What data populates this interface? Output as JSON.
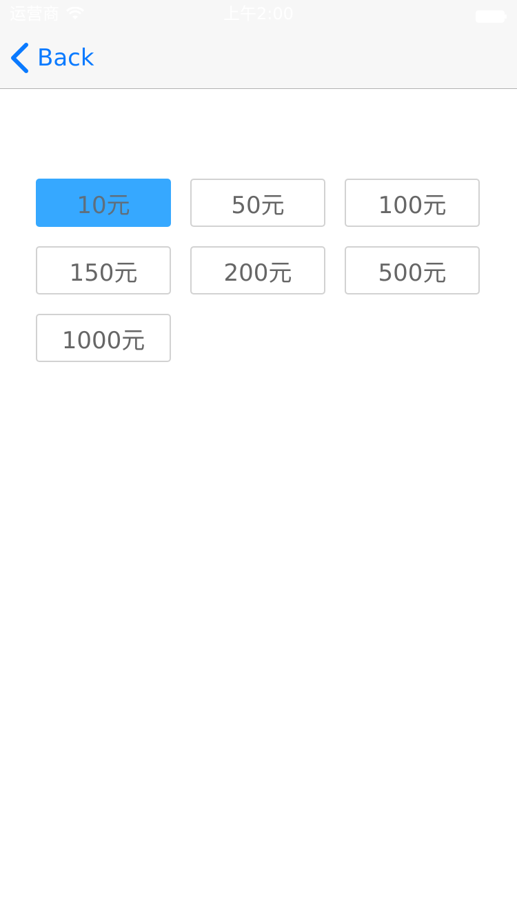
{
  "status_bar": {
    "carrier": "运营商",
    "time": "上午2:00",
    "wifi_icon": "wifi-icon",
    "battery_icon": "battery-icon"
  },
  "nav": {
    "back_label": "Back",
    "back_icon": "chevron-left-icon",
    "accent_color": "#0a7aff"
  },
  "amounts": {
    "selected_index": 0,
    "selected_color": "#36a8ff",
    "options": [
      {
        "label": "10元"
      },
      {
        "label": "50元"
      },
      {
        "label": "100元"
      },
      {
        "label": "150元"
      },
      {
        "label": "200元"
      },
      {
        "label": "500元"
      },
      {
        "label": "1000元"
      }
    ]
  }
}
